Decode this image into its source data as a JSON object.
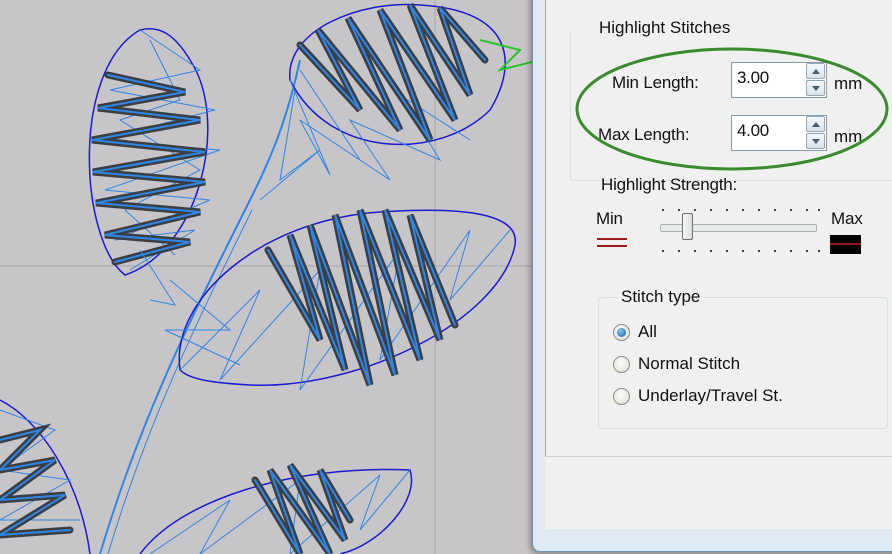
{
  "highlight_stitches": {
    "group_label": "Highlight Stitches",
    "min_length": {
      "label": "Min Length:",
      "value": "3.00",
      "unit": "mm"
    },
    "max_length": {
      "label": "Max Length:",
      "value": "4.00",
      "unit": "mm"
    }
  },
  "highlight_strength": {
    "label": "Highlight Strength:",
    "min_label": "Min",
    "max_label": "Max",
    "slider_value_fraction": 0.15
  },
  "stitch_type": {
    "group_label": "Stitch type",
    "options": [
      {
        "label": "All",
        "selected": true
      },
      {
        "label": "Normal Stitch",
        "selected": false
      },
      {
        "label": "Underlay/Travel St.",
        "selected": false
      }
    ]
  },
  "colors": {
    "canvas_bg": "#c8c5c8",
    "stitch_dark": "#3b3f44",
    "stitch_blue": "#2f86e6",
    "outline_blue": "#1a1ad0",
    "highlight_ellipse": "#3a8a2e",
    "min_swatch": "#9b1a1a",
    "max_swatch": "#000000"
  }
}
